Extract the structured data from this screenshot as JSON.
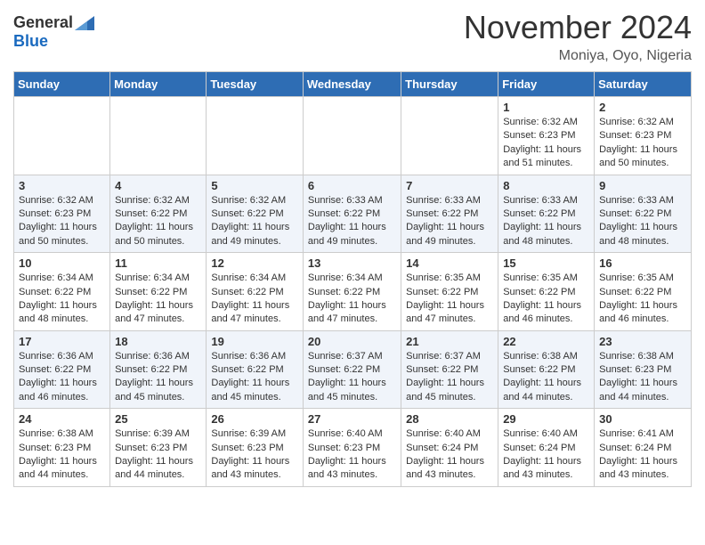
{
  "header": {
    "logo_general": "General",
    "logo_blue": "Blue",
    "month_title": "November 2024",
    "location": "Moniya, Oyo, Nigeria"
  },
  "days_of_week": [
    "Sunday",
    "Monday",
    "Tuesday",
    "Wednesday",
    "Thursday",
    "Friday",
    "Saturday"
  ],
  "weeks": [
    [
      {
        "day": "",
        "info": ""
      },
      {
        "day": "",
        "info": ""
      },
      {
        "day": "",
        "info": ""
      },
      {
        "day": "",
        "info": ""
      },
      {
        "day": "",
        "info": ""
      },
      {
        "day": "1",
        "info": "Sunrise: 6:32 AM\nSunset: 6:23 PM\nDaylight: 11 hours and 51 minutes."
      },
      {
        "day": "2",
        "info": "Sunrise: 6:32 AM\nSunset: 6:23 PM\nDaylight: 11 hours and 50 minutes."
      }
    ],
    [
      {
        "day": "3",
        "info": "Sunrise: 6:32 AM\nSunset: 6:23 PM\nDaylight: 11 hours and 50 minutes."
      },
      {
        "day": "4",
        "info": "Sunrise: 6:32 AM\nSunset: 6:22 PM\nDaylight: 11 hours and 50 minutes."
      },
      {
        "day": "5",
        "info": "Sunrise: 6:32 AM\nSunset: 6:22 PM\nDaylight: 11 hours and 49 minutes."
      },
      {
        "day": "6",
        "info": "Sunrise: 6:33 AM\nSunset: 6:22 PM\nDaylight: 11 hours and 49 minutes."
      },
      {
        "day": "7",
        "info": "Sunrise: 6:33 AM\nSunset: 6:22 PM\nDaylight: 11 hours and 49 minutes."
      },
      {
        "day": "8",
        "info": "Sunrise: 6:33 AM\nSunset: 6:22 PM\nDaylight: 11 hours and 48 minutes."
      },
      {
        "day": "9",
        "info": "Sunrise: 6:33 AM\nSunset: 6:22 PM\nDaylight: 11 hours and 48 minutes."
      }
    ],
    [
      {
        "day": "10",
        "info": "Sunrise: 6:34 AM\nSunset: 6:22 PM\nDaylight: 11 hours and 48 minutes."
      },
      {
        "day": "11",
        "info": "Sunrise: 6:34 AM\nSunset: 6:22 PM\nDaylight: 11 hours and 47 minutes."
      },
      {
        "day": "12",
        "info": "Sunrise: 6:34 AM\nSunset: 6:22 PM\nDaylight: 11 hours and 47 minutes."
      },
      {
        "day": "13",
        "info": "Sunrise: 6:34 AM\nSunset: 6:22 PM\nDaylight: 11 hours and 47 minutes."
      },
      {
        "day": "14",
        "info": "Sunrise: 6:35 AM\nSunset: 6:22 PM\nDaylight: 11 hours and 47 minutes."
      },
      {
        "day": "15",
        "info": "Sunrise: 6:35 AM\nSunset: 6:22 PM\nDaylight: 11 hours and 46 minutes."
      },
      {
        "day": "16",
        "info": "Sunrise: 6:35 AM\nSunset: 6:22 PM\nDaylight: 11 hours and 46 minutes."
      }
    ],
    [
      {
        "day": "17",
        "info": "Sunrise: 6:36 AM\nSunset: 6:22 PM\nDaylight: 11 hours and 46 minutes."
      },
      {
        "day": "18",
        "info": "Sunrise: 6:36 AM\nSunset: 6:22 PM\nDaylight: 11 hours and 45 minutes."
      },
      {
        "day": "19",
        "info": "Sunrise: 6:36 AM\nSunset: 6:22 PM\nDaylight: 11 hours and 45 minutes."
      },
      {
        "day": "20",
        "info": "Sunrise: 6:37 AM\nSunset: 6:22 PM\nDaylight: 11 hours and 45 minutes."
      },
      {
        "day": "21",
        "info": "Sunrise: 6:37 AM\nSunset: 6:22 PM\nDaylight: 11 hours and 45 minutes."
      },
      {
        "day": "22",
        "info": "Sunrise: 6:38 AM\nSunset: 6:22 PM\nDaylight: 11 hours and 44 minutes."
      },
      {
        "day": "23",
        "info": "Sunrise: 6:38 AM\nSunset: 6:23 PM\nDaylight: 11 hours and 44 minutes."
      }
    ],
    [
      {
        "day": "24",
        "info": "Sunrise: 6:38 AM\nSunset: 6:23 PM\nDaylight: 11 hours and 44 minutes."
      },
      {
        "day": "25",
        "info": "Sunrise: 6:39 AM\nSunset: 6:23 PM\nDaylight: 11 hours and 44 minutes."
      },
      {
        "day": "26",
        "info": "Sunrise: 6:39 AM\nSunset: 6:23 PM\nDaylight: 11 hours and 43 minutes."
      },
      {
        "day": "27",
        "info": "Sunrise: 6:40 AM\nSunset: 6:23 PM\nDaylight: 11 hours and 43 minutes."
      },
      {
        "day": "28",
        "info": "Sunrise: 6:40 AM\nSunset: 6:24 PM\nDaylight: 11 hours and 43 minutes."
      },
      {
        "day": "29",
        "info": "Sunrise: 6:40 AM\nSunset: 6:24 PM\nDaylight: 11 hours and 43 minutes."
      },
      {
        "day": "30",
        "info": "Sunrise: 6:41 AM\nSunset: 6:24 PM\nDaylight: 11 hours and 43 minutes."
      }
    ]
  ]
}
